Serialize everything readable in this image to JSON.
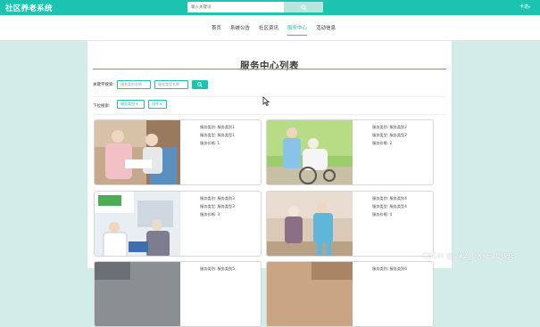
{
  "app": {
    "brand": "社区养老系统",
    "search_placeholder": "输入关键词",
    "user_label": "卡诺"
  },
  "nav": {
    "items": [
      {
        "label": "首页",
        "active": false
      },
      {
        "label": "系统公告",
        "active": false
      },
      {
        "label": "社区资讯",
        "active": false
      },
      {
        "label": "服务中心",
        "active": true
      },
      {
        "label": "活动信息",
        "active": false
      }
    ]
  },
  "page": {
    "title": "服务中心列表",
    "keyword_label": "关键字搜索:",
    "keyword_placeholder_1": "服务类别名称",
    "keyword_placeholder_2": "服务类型名称",
    "sort_label": "下拉搜索:",
    "sort_btn_1": "服务类型",
    "sort_btn_2": "排序"
  },
  "cards": [
    {
      "l1": "服务类别: 服务类别1",
      "l2": "服务类型: 服务类型1",
      "l3": "服务价格: 1"
    },
    {
      "l1": "服务类别: 服务类别2",
      "l2": "服务类型: 服务类型2",
      "l3": "服务价格: 2"
    },
    {
      "l1": "服务类别: 服务类别3",
      "l2": "服务类型: 服务类型3",
      "l3": "服务价格: 3"
    },
    {
      "l1": "服务类别: 服务类别4",
      "l2": "服务类型: 服务类型4",
      "l3": "服务价格: 4"
    },
    {
      "l1": "服务类别: 服务类别5",
      "l2": "",
      "l3": ""
    },
    {
      "l1": "服务类别: 服务类别6",
      "l2": "",
      "l3": ""
    }
  ],
  "watermark": "CSDN @vx2_CXKF10088",
  "colors": {
    "accent": "#1bc3b0",
    "page_bg": "#d4ece8"
  }
}
